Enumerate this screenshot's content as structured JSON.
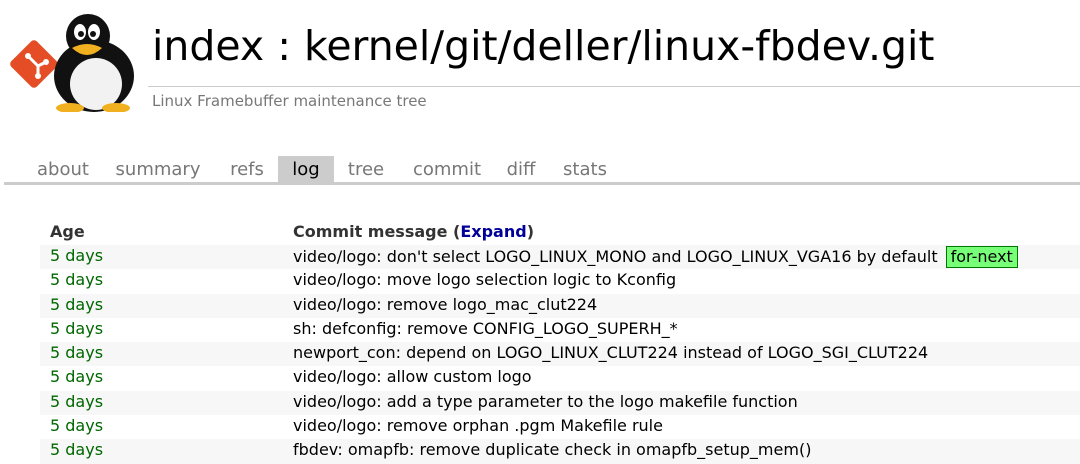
{
  "header": {
    "title": "index : kernel/git/deller/linux-fbdev.git",
    "description": "Linux Framebuffer maintenance tree"
  },
  "tabs": [
    {
      "label": "about",
      "active": false
    },
    {
      "label": "summary",
      "active": false
    },
    {
      "label": "refs",
      "active": false
    },
    {
      "label": "log",
      "active": true
    },
    {
      "label": "tree",
      "active": false
    },
    {
      "label": "commit",
      "active": false
    },
    {
      "label": "diff",
      "active": false
    },
    {
      "label": "stats",
      "active": false
    }
  ],
  "log": {
    "col_age": "Age",
    "col_msg_prefix": "Commit message (",
    "expand_label": "Expand",
    "col_msg_suffix": ")",
    "rows": [
      {
        "age": "5 days",
        "message": "video/logo: don't select LOGO_LINUX_MONO and LOGO_LINUX_VGA16 by default",
        "badge": "for-next"
      },
      {
        "age": "5 days",
        "message": "video/logo: move logo selection logic to Kconfig"
      },
      {
        "age": "5 days",
        "message": "video/logo: remove logo_mac_clut224"
      },
      {
        "age": "5 days",
        "message": "sh: defconfig: remove CONFIG_LOGO_SUPERH_*"
      },
      {
        "age": "5 days",
        "message": "newport_con: depend on LOGO_LINUX_CLUT224 instead of LOGO_SGI_CLUT224"
      },
      {
        "age": "5 days",
        "message": "video/logo: allow custom logo"
      },
      {
        "age": "5 days",
        "message": "video/logo: add a type parameter to the logo makefile function"
      },
      {
        "age": "5 days",
        "message": "video/logo: remove orphan .pgm Makefile rule"
      },
      {
        "age": "5 days",
        "message": "fbdev: omapfb: remove duplicate check in omapfb_setup_mem()"
      }
    ]
  },
  "colors": {
    "age_green": "#006600",
    "badge_bg": "#77ff77",
    "link_blue": "#000099",
    "tab_active_bg": "#cccccc"
  }
}
